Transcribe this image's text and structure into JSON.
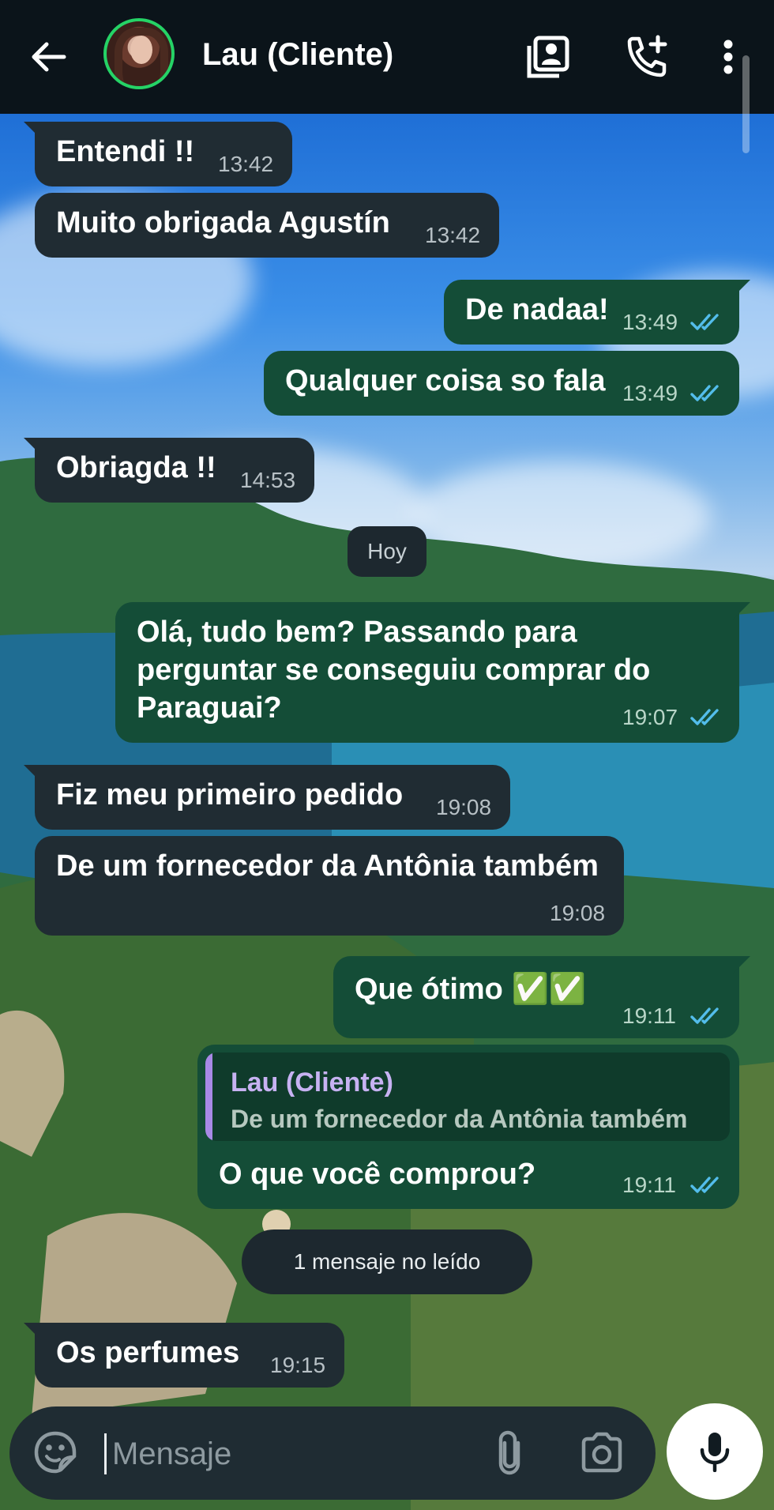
{
  "header": {
    "contact_name": "Lau (Cliente)",
    "icons": [
      "back-arrow-icon",
      "avatar",
      "contact-card-icon",
      "add-call-icon",
      "more-vert-icon"
    ]
  },
  "messages": [
    {
      "direction": "in",
      "text": "Entendi !!",
      "time": "13:42"
    },
    {
      "direction": "in",
      "text": "Muito obrigada Agustín",
      "time": "13:42"
    },
    {
      "direction": "out",
      "text": "De nadaa!",
      "time": "13:49",
      "status": "read"
    },
    {
      "direction": "out",
      "text": "Qualquer coisa so fala",
      "time": "13:49",
      "status": "read"
    },
    {
      "direction": "in",
      "text": "Obriagda !!",
      "time": "14:53"
    },
    {
      "direction": "out",
      "text": "Olá, tudo bem? Passando para perguntar se conseguiu comprar do Paraguai?",
      "time": "19:07",
      "status": "read"
    },
    {
      "direction": "in",
      "text": "Fiz meu primeiro pedido",
      "time": "19:08"
    },
    {
      "direction": "in",
      "text": "De um fornecedor da Antônia também",
      "time": "19:08"
    },
    {
      "direction": "out",
      "text": "Que ótimo ✅✅",
      "time": "19:11",
      "status": "read"
    },
    {
      "direction": "out",
      "text": "O que você comprou?",
      "time": "19:11",
      "status": "read",
      "quote": {
        "author": "Lau (Cliente)",
        "text": "De um fornecedor da Antônia também"
      }
    },
    {
      "direction": "in",
      "text": "Os perfumes",
      "time": "19:15"
    }
  ],
  "date_separator": "Hoy",
  "unread_separator": "1 mensaje no leído",
  "composer": {
    "placeholder": "Mensaje",
    "value": ""
  },
  "colors": {
    "header_bg": "#0b141a",
    "incoming_bubble": "#202c33",
    "outgoing_bubble": "#144d37",
    "read_ticks": "#53bdeb",
    "avatar_ring": "#25d366"
  }
}
